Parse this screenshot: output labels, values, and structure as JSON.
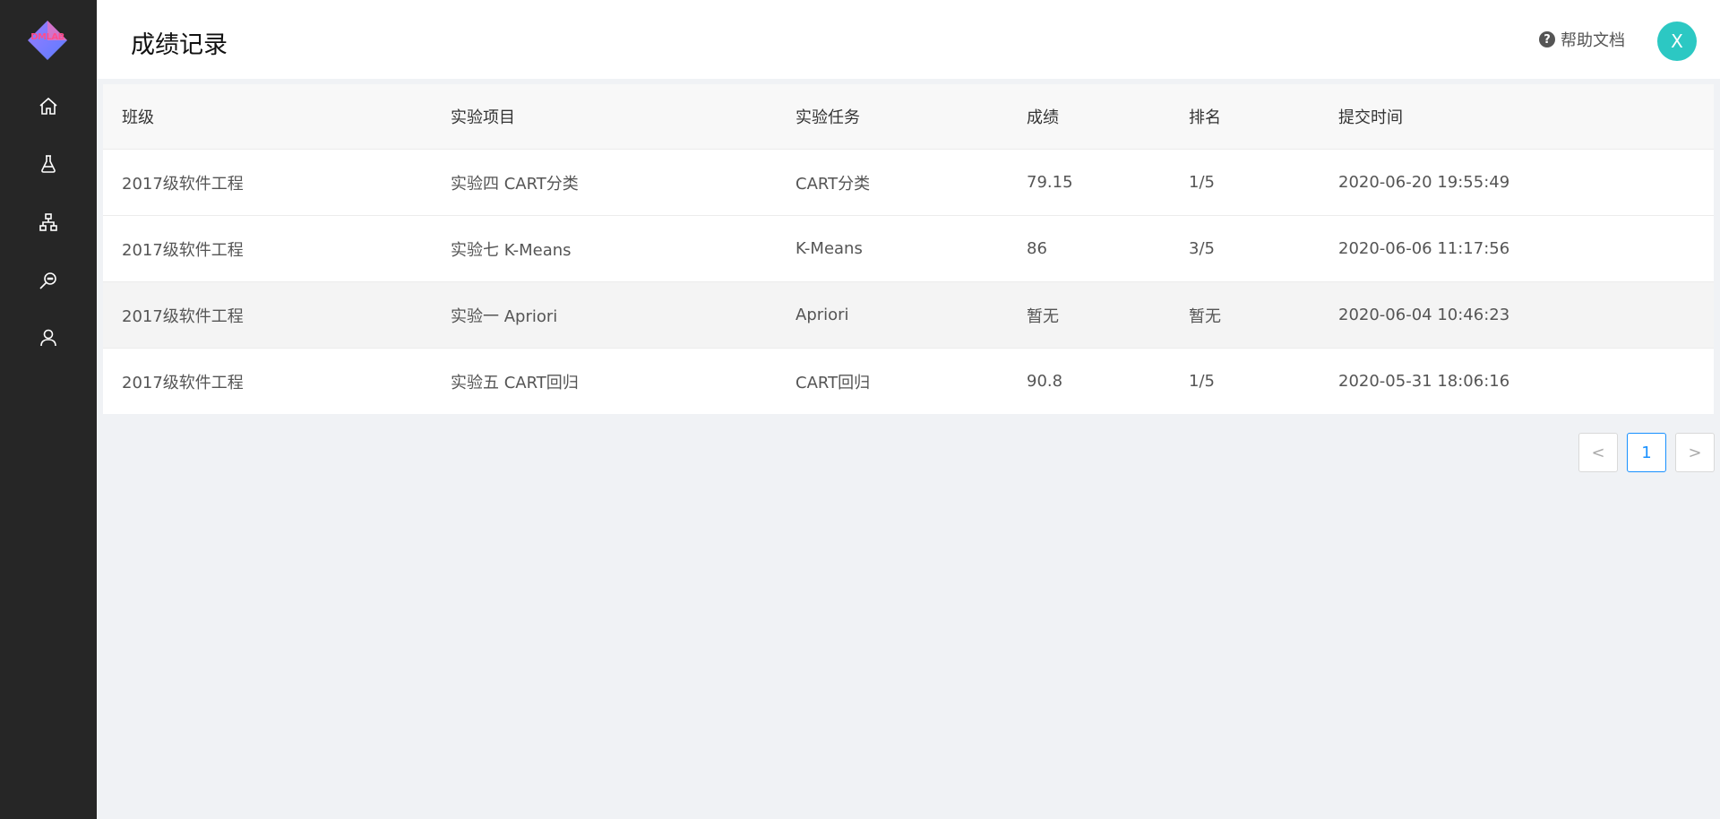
{
  "app": {
    "logo_text": "DMLAB"
  },
  "sidebar": {
    "items": [
      {
        "icon": "home-icon"
      },
      {
        "icon": "flask-icon"
      },
      {
        "icon": "hierarchy-icon"
      },
      {
        "icon": "search-chat-icon"
      },
      {
        "icon": "user-icon"
      }
    ]
  },
  "header": {
    "title": "成绩记录",
    "help_icon": "?",
    "help_label": "帮助文档",
    "avatar_letter": "X"
  },
  "table": {
    "columns": [
      "班级",
      "实验项目",
      "实验任务",
      "成绩",
      "排名",
      "提交时间"
    ],
    "rows": [
      [
        "2017级软件工程",
        "实验四 CART分类",
        "CART分类",
        "79.15",
        "1/5",
        "2020-06-20 19:55:49"
      ],
      [
        "2017级软件工程",
        "实验七 K-Means",
        "K-Means",
        "86",
        "3/5",
        "2020-06-06 11:17:56"
      ],
      [
        "2017级软件工程",
        "实验一 Apriori",
        "Apriori",
        "暂无",
        "暂无",
        "2020-06-04 10:46:23"
      ],
      [
        "2017级软件工程",
        "实验五 CART回归",
        "CART回归",
        "90.8",
        "1/5",
        "2020-05-31 18:06:16"
      ]
    ]
  },
  "pagination": {
    "prev": "<",
    "current": "1",
    "next": ">"
  },
  "colors": {
    "sidebar_bg": "#262626",
    "accent": "#1890ff",
    "avatar_bg": "#2cc8c3",
    "page_bg": "#f0f2f5"
  }
}
